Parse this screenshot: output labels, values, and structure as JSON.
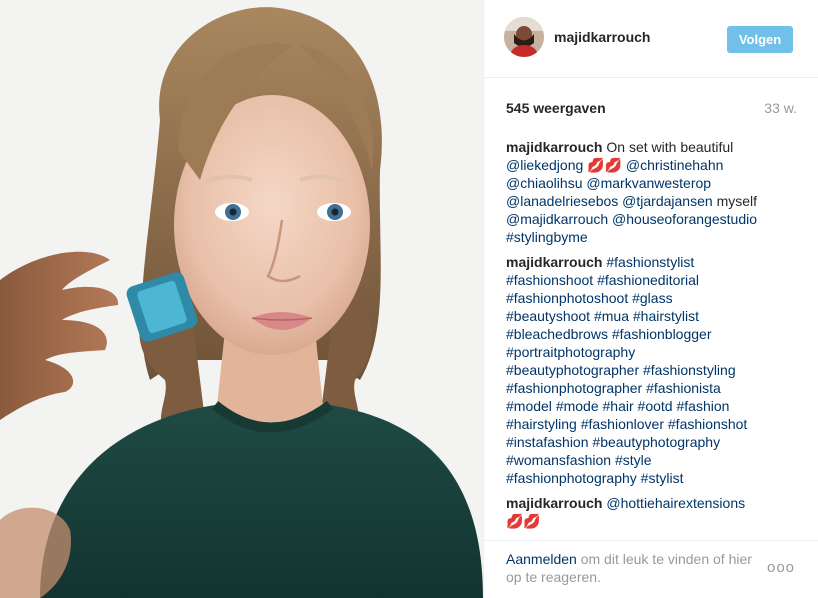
{
  "post": {
    "username": "majidkarrouch",
    "follow_label": "Volgen",
    "views": "545 weergaven",
    "age": "33 w."
  },
  "comments": [
    {
      "author": "majidkarrouch",
      "text": "On set with beautiful\n@liekedjong 💋💋 @christinehahn\n@chiaolihsu @markvanwesterop\n@lanadelriesebos @tjardajansen myself\n@majidkarrouch @houseoforangestudio\n#stylingbyme"
    },
    {
      "author": "majidkarrouch",
      "text": "#fashionstylist\n#fashionshoot #fashioneditorial\n#fashionphotoshoot #glass\n#beautyshoot #mua #hairstylist\n#bleachedbrows #fashionblogger\n#portraitphotography\n#beautyphotographer #fashionstyling\n#fashionphotographer #fashionista\n#model #mode #hair #ootd #fashion\n#hairstyling #fashionlover #fashionshot\n#instafashion #beautyphotography\n#womansfashion #style\n#fashionphotography #stylist"
    },
    {
      "author": "majidkarrouch",
      "text": "@hottiehairextensions\n💋💋"
    }
  ],
  "footer": {
    "login_link": "Aanmelden",
    "login_rest": "om dit leuk te vinden of hier op te reageren.",
    "more_label": "ooo"
  },
  "icons": {
    "avatar": "profile-photo",
    "more": "more-options-icon"
  },
  "colors": {
    "follow_button": "#70c0ea",
    "link": "#003569",
    "muted": "#999999"
  }
}
